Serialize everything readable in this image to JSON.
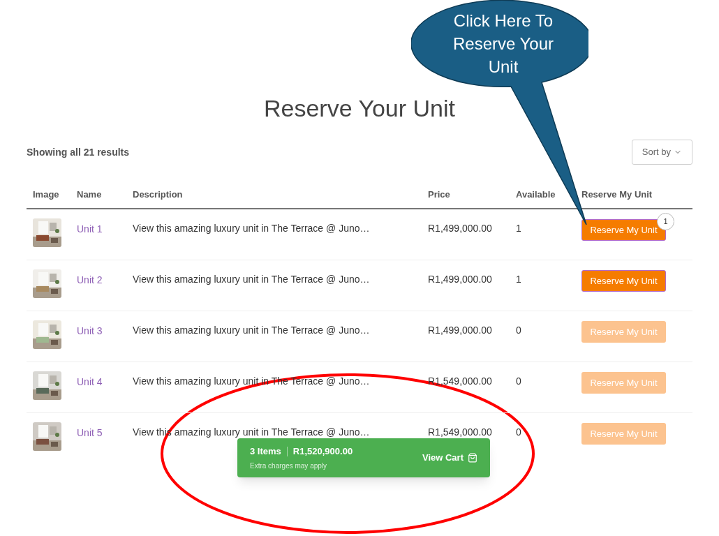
{
  "callout": {
    "text": "Click Here To Reserve Your Unit"
  },
  "title": "Reserve Your Unit",
  "result_count": "Showing all 21 results",
  "sort": {
    "label": "Sort by"
  },
  "table": {
    "columns": [
      "Image",
      "Name",
      "Description",
      "Price",
      "Available",
      "Reserve My Unit"
    ],
    "rows": [
      {
        "name": "Unit 1",
        "description": "View this amazing luxury unit in The Terrace @ Juno…",
        "price": "R1,499,000.00",
        "available": "1",
        "button": "Reserve My Unit",
        "disabled": false,
        "badge": "1"
      },
      {
        "name": "Unit 2",
        "description": "View this amazing luxury unit in The Terrace @ Juno…",
        "price": "R1,499,000.00",
        "available": "1",
        "button": "Reserve My Unit",
        "disabled": false
      },
      {
        "name": "Unit 3",
        "description": "View this amazing luxury unit in The Terrace @ Juno…",
        "price": "R1,499,000.00",
        "available": "0",
        "button": "Reserve My Unit",
        "disabled": true
      },
      {
        "name": "Unit 4",
        "description": "View this amazing luxury unit in The Terrace @ Juno…",
        "price": "R1,549,000.00",
        "available": "0",
        "button": "Reserve My Unit",
        "disabled": true
      },
      {
        "name": "Unit 5",
        "description": "View this amazing luxury unit in The Terrace @ Juno…",
        "price": "R1,549,000.00",
        "available": "0",
        "button": "Reserve My Unit",
        "disabled": true
      }
    ]
  },
  "cart_bar": {
    "items": "3 Items",
    "total": "R1,520,900.00",
    "note": "Extra charges may apply",
    "action": "View Cart"
  }
}
